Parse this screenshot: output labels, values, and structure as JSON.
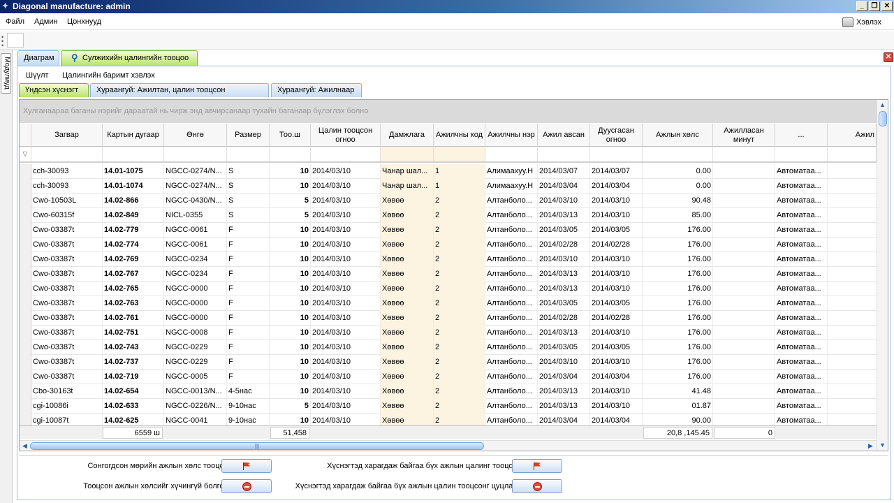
{
  "window": {
    "title": "Diagonal manufacture: admin"
  },
  "menu": {
    "file": "Файл",
    "admin": "Админ",
    "windows": "Цонхнууд",
    "print": "Хэвлэх"
  },
  "side": {
    "modules": "Модулиуд"
  },
  "tabs": {
    "diagram": "Диаграм",
    "calc": "Сулжихийн цалингийн тооцоо"
  },
  "submenu": {
    "filter": "Шүүлт",
    "print_doc": "Цалингийн баримт хэвлэх"
  },
  "inner_tabs": [
    "Үндсэн хүснэгт",
    "Хураангуй: Ажилтан, цалин тооцсон огноогоор",
    "Хураангуй: Ажилнаар"
  ],
  "grid": {
    "group_hint": "Хулганаараа баганы нэрийг дараатай нь чирж энд авчирсанаар тухайн баганаар бүлэглэх болно",
    "columns": [
      "Загвар",
      "Картын дугаар",
      "Өнгө",
      "Размер",
      "Тоо.ш",
      "Цалин тооцсон огноо",
      "Дамжлага",
      "Ажилчны код",
      "Ажилчны нэр",
      "Ажил авсан",
      "Дуусгасан огноо",
      "Ажлын хөлс",
      "Ажилласан минут",
      "...",
      "Ажил"
    ],
    "rows": [
      [
        "cch-30093",
        "14.01-1075",
        "NGCC-0274/N...",
        "S",
        "10",
        "2014/03/10",
        "Чанар шал...",
        "1",
        "Алимаахуу.Н",
        "2014/03/07",
        "2014/03/07",
        "0.00",
        "",
        "Автоматаа..."
      ],
      [
        "cch-30093",
        "14.01-1074",
        "NGCC-0274/N...",
        "S",
        "10",
        "2014/03/10",
        "Чанар шал...",
        "1",
        "Алимаахуу.Н",
        "2014/03/04",
        "2014/03/04",
        "0.00",
        "",
        "Автоматаа..."
      ],
      [
        "Cwo-10503L",
        "14.02-866",
        "NGCC-0430/N...",
        "S",
        "5",
        "2014/03/10",
        "Хөвөө",
        "2",
        "Алтанболо...",
        "2014/03/10",
        "2014/03/10",
        "90.48",
        "",
        "Автоматаа..."
      ],
      [
        "Cwo-60315f",
        "14.02-849",
        "NICL-0355",
        "S",
        "5",
        "2014/03/10",
        "Хөвөө",
        "2",
        "Алтанболо...",
        "2014/03/13",
        "2014/03/10",
        "85.00",
        "",
        "Автоматаа..."
      ],
      [
        "Cwo-03387t",
        "14.02-779",
        "NGCC-0061",
        "F",
        "10",
        "2014/03/10",
        "Хөвөө",
        "2",
        "Алтанболо...",
        "2014/03/05",
        "2014/03/05",
        "176.00",
        "",
        "Автоматаа..."
      ],
      [
        "Cwo-03387t",
        "14.02-774",
        "NGCC-0061",
        "F",
        "10",
        "2014/03/10",
        "Хөвөө",
        "2",
        "Алтанболо...",
        "2014/02/28",
        "2014/02/28",
        "176.00",
        "",
        "Автоматаа..."
      ],
      [
        "Cwo-03387t",
        "14.02-769",
        "NGCC-0234",
        "F",
        "10",
        "2014/03/10",
        "Хөвөө",
        "2",
        "Алтанболо...",
        "2014/03/10",
        "2014/03/10",
        "176.00",
        "",
        "Автоматаа..."
      ],
      [
        "Cwo-03387t",
        "14.02-767",
        "NGCC-0234",
        "F",
        "10",
        "2014/03/10",
        "Хөвөө",
        "2",
        "Алтанболо...",
        "2014/03/13",
        "2014/03/10",
        "176.00",
        "",
        "Автоматаа..."
      ],
      [
        "Cwo-03387t",
        "14.02-765",
        "NGCC-0000",
        "F",
        "10",
        "2014/03/10",
        "Хөвөө",
        "2",
        "Алтанболо...",
        "2014/03/13",
        "2014/03/10",
        "176.00",
        "",
        "Автоматаа..."
      ],
      [
        "Cwo-03387t",
        "14.02-763",
        "NGCC-0000",
        "F",
        "10",
        "2014/03/10",
        "Хөвөө",
        "2",
        "Алтанболо...",
        "2014/03/05",
        "2014/03/05",
        "176.00",
        "",
        "Автоматаа..."
      ],
      [
        "Cwo-03387t",
        "14.02-761",
        "NGCC-0000",
        "F",
        "10",
        "2014/03/10",
        "Хөвөө",
        "2",
        "Алтанболо...",
        "2014/02/28",
        "2014/02/28",
        "176.00",
        "",
        "Автоматаа..."
      ],
      [
        "Cwo-03387t",
        "14.02-751",
        "NGCC-0008",
        "F",
        "10",
        "2014/03/10",
        "Хөвөө",
        "2",
        "Алтанболо...",
        "2014/03/13",
        "2014/03/10",
        "176.00",
        "",
        "Автоматаа..."
      ],
      [
        "Cwo-03387t",
        "14.02-743",
        "NGCC-0229",
        "F",
        "10",
        "2014/03/10",
        "Хөвөө",
        "2",
        "Алтанболо...",
        "2014/03/05",
        "2014/03/05",
        "176.00",
        "",
        "Автоматаа..."
      ],
      [
        "Cwo-03387t",
        "14.02-737",
        "NGCC-0229",
        "F",
        "10",
        "2014/03/10",
        "Хөвөө",
        "2",
        "Алтанболо...",
        "2014/03/10",
        "2014/03/10",
        "176.00",
        "",
        "Автоматаа..."
      ],
      [
        "Cwo-03387t",
        "14.02-719",
        "NGCC-0005",
        "F",
        "10",
        "2014/03/10",
        "Хөвөө",
        "2",
        "Алтанболо...",
        "2014/03/04",
        "2014/03/04",
        "176.00",
        "",
        "Автоматаа..."
      ],
      [
        "Cbo-30163t",
        "14.02-654",
        "NGCC-0013/N...",
        "4-5нас",
        "10",
        "2014/03/10",
        "Хөвөө",
        "2",
        "Алтанболо...",
        "2014/03/13",
        "2014/03/10",
        "41.48",
        "",
        "Автоматаа..."
      ],
      [
        "cgi-10086i",
        "14.02-633",
        "NGCC-0226/N...",
        "9-10нас",
        "5",
        "2014/03/10",
        "Хөвөө",
        "2",
        "Алтанболо...",
        "2014/03/13",
        "2014/03/10",
        "01.87",
        "",
        "Автоматаа..."
      ],
      [
        "cgi-10087t",
        "14.02-625",
        "NGCC-0041",
        "9-10нас",
        "10",
        "2014/03/10",
        "Хөвөө",
        "2",
        "Алтанболо...",
        "2014/03/04",
        "2014/03/04",
        "90.00",
        "",
        "Автоматаа..."
      ]
    ],
    "totals": {
      "cards": "6559 ш",
      "qty": "51,458",
      "wage": "20,8 ,145.45",
      "minutes": "0"
    }
  },
  "actions": {
    "calc_selected": "Сонгогдсон мөрийн ажлын хөлс тооцох :",
    "invalidate": "Тооцсон ажлын хөлсийг хүчингүй болгох :",
    "calc_all": "Хүснэгтэд харагдаж байгаа бүх ажлын цалинг тооцох :",
    "cancel_all": "Хүснэгтэд харагдаж байгаа бүх ажлын цалин тооцсонг цуцлах :"
  }
}
